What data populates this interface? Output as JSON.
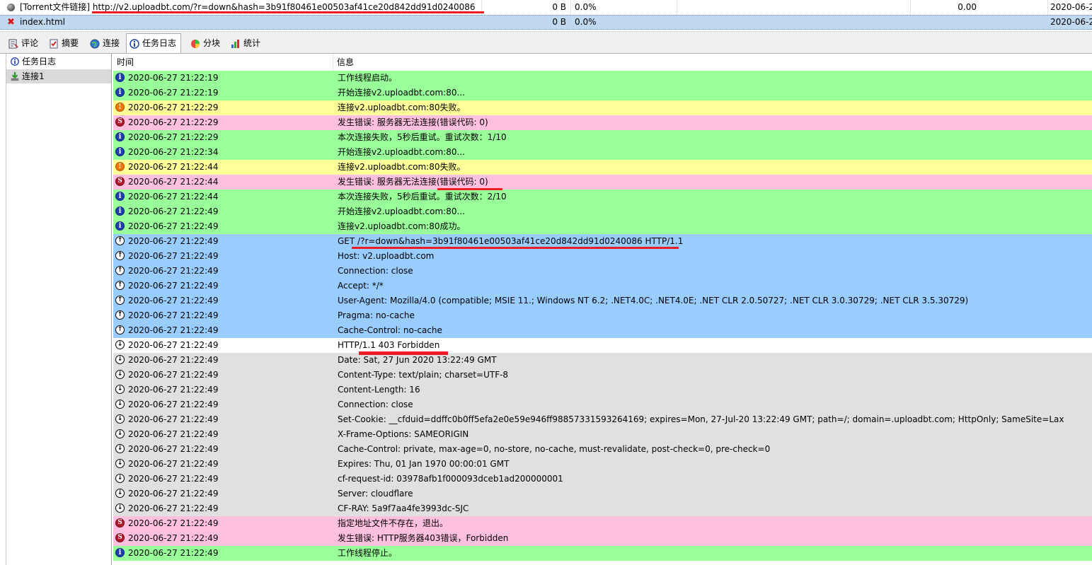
{
  "tasks": [
    {
      "name": "[Torrent文件链接] http://v2.uploadbt.com/?r=down&hash=3b91f80461e00503af41ce20d842dd91d0240086",
      "size": "0 B",
      "percent": "0.0%",
      "speed": "0.00",
      "date": "2020-06-2",
      "status_icon": "grey-dot-icon"
    },
    {
      "name": "index.html",
      "size": "0 B",
      "percent": "0.0%",
      "speed": "",
      "date": "2020-06-2",
      "status_icon": "red-x-icon"
    }
  ],
  "tabs": [
    {
      "label": "评论",
      "icon": "comment-icon"
    },
    {
      "label": "摘要",
      "icon": "checklist-icon"
    },
    {
      "label": "连接",
      "icon": "globe-icon"
    },
    {
      "label": "任务日志",
      "icon": "info-log-icon",
      "active": true
    },
    {
      "label": "分块",
      "icon": "pie-icon"
    },
    {
      "label": "统计",
      "icon": "stats-icon"
    }
  ],
  "tree": [
    {
      "label": "任务日志",
      "icon": "info-log-icon"
    },
    {
      "label": "连接1",
      "icon": "connection-icon",
      "selected": true
    }
  ],
  "log_header": {
    "time": "时间",
    "info": "信息"
  },
  "log": [
    {
      "type": "info",
      "time": "2020-06-27 21:22:19",
      "msg": "工作线程启动。"
    },
    {
      "type": "info",
      "time": "2020-06-27 21:22:19",
      "msg": "开始连接v2.uploadbt.com:80..."
    },
    {
      "type": "warn",
      "time": "2020-06-27 21:22:29",
      "msg": "连接v2.uploadbt.com:80失败。"
    },
    {
      "type": "error",
      "time": "2020-06-27 21:22:29",
      "msg": "发生错误: 服务器无法连接(错误代码: 0)"
    },
    {
      "type": "info",
      "time": "2020-06-27 21:22:29",
      "msg": "本次连接失败，5秒后重试。重试次数：1/10"
    },
    {
      "type": "info",
      "time": "2020-06-27 21:22:34",
      "msg": "开始连接v2.uploadbt.com:80..."
    },
    {
      "type": "warn",
      "time": "2020-06-27 21:22:44",
      "msg": "连接v2.uploadbt.com:80失败。"
    },
    {
      "type": "error",
      "time": "2020-06-27 21:22:44",
      "msg": "发生错误: 服务器无法连接(错误代码: 0)"
    },
    {
      "type": "info",
      "time": "2020-06-27 21:22:44",
      "msg": "本次连接失败，5秒后重试。重试次数：2/10"
    },
    {
      "type": "info",
      "time": "2020-06-27 21:22:49",
      "msg": "开始连接v2.uploadbt.com:80..."
    },
    {
      "type": "info",
      "time": "2020-06-27 21:22:49",
      "msg": "连接v2.uploadbt.com:80成功。"
    },
    {
      "type": "send",
      "time": "2020-06-27 21:22:49",
      "msg": "GET /?r=down&hash=3b91f80461e00503af41ce20d842dd91d0240086 HTTP/1.1"
    },
    {
      "type": "send",
      "time": "2020-06-27 21:22:49",
      "msg": "Host: v2.uploadbt.com"
    },
    {
      "type": "send",
      "time": "2020-06-27 21:22:49",
      "msg": "Connection: close"
    },
    {
      "type": "send",
      "time": "2020-06-27 21:22:49",
      "msg": "Accept: */*"
    },
    {
      "type": "send",
      "time": "2020-06-27 21:22:49",
      "msg": "User-Agent: Mozilla/4.0 (compatible; MSIE 11.; Windows NT 6.2; .NET4.0C; .NET4.0E; .NET CLR 2.0.50727; .NET CLR 3.0.30729; .NET CLR 3.5.30729)"
    },
    {
      "type": "send",
      "time": "2020-06-27 21:22:49",
      "msg": "Pragma: no-cache"
    },
    {
      "type": "send",
      "time": "2020-06-27 21:22:49",
      "msg": "Cache-Control: no-cache"
    },
    {
      "type": "recv",
      "time": "2020-06-27 21:22:49",
      "msg": "HTTP/1.1 403 Forbidden",
      "focused": true
    },
    {
      "type": "recv",
      "time": "2020-06-27 21:22:49",
      "msg": "Date: Sat, 27 Jun 2020 13:22:49 GMT"
    },
    {
      "type": "recv",
      "time": "2020-06-27 21:22:49",
      "msg": "Content-Type: text/plain; charset=UTF-8"
    },
    {
      "type": "recv",
      "time": "2020-06-27 21:22:49",
      "msg": "Content-Length: 16"
    },
    {
      "type": "recv",
      "time": "2020-06-27 21:22:49",
      "msg": "Connection: close"
    },
    {
      "type": "recv",
      "time": "2020-06-27 21:22:49",
      "msg": "Set-Cookie: __cfduid=ddffc0b0ff5efa2e0e59e946ff98857331593264169; expires=Mon, 27-Jul-20 13:22:49 GMT; path=/; domain=.uploadbt.com; HttpOnly; SameSite=Lax"
    },
    {
      "type": "recv",
      "time": "2020-06-27 21:22:49",
      "msg": "X-Frame-Options: SAMEORIGIN"
    },
    {
      "type": "recv",
      "time": "2020-06-27 21:22:49",
      "msg": "Cache-Control: private, max-age=0, no-store, no-cache, must-revalidate, post-check=0, pre-check=0"
    },
    {
      "type": "recv",
      "time": "2020-06-27 21:22:49",
      "msg": "Expires: Thu, 01 Jan 1970 00:00:01 GMT"
    },
    {
      "type": "recv",
      "time": "2020-06-27 21:22:49",
      "msg": "cf-request-id: 03978afb1f000093dceb1ad200000001"
    },
    {
      "type": "recv",
      "time": "2020-06-27 21:22:49",
      "msg": "Server: cloudflare"
    },
    {
      "type": "recv",
      "time": "2020-06-27 21:22:49",
      "msg": "CF-RAY: 5a9f7aa4fe3993dc-SJC"
    },
    {
      "type": "error",
      "time": "2020-06-27 21:22:49",
      "msg": "指定地址文件不存在，退出。"
    },
    {
      "type": "error",
      "time": "2020-06-27 21:22:49",
      "msg": "发生错误: HTTP服务器403错误，Forbidden"
    },
    {
      "type": "info",
      "time": "2020-06-27 21:22:49",
      "msg": "工作线程停止。"
    }
  ],
  "colors": {
    "info_bg": "#99ff99",
    "warn_bg": "#ffff99",
    "error_bg": "#ffc0e0",
    "send_bg": "#99ccff",
    "recv_bg": "#e0e0e0",
    "markup_red": "#ee1c24"
  }
}
